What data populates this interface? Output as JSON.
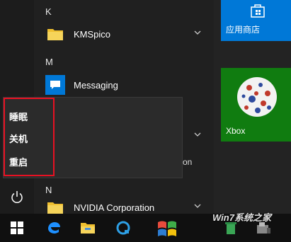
{
  "start_menu": {
    "sections": [
      {
        "letter": "K",
        "apps": [
          {
            "label": "KMSpico",
            "icon": "folder-icon",
            "has_chevron": true
          }
        ]
      },
      {
        "letter": "M",
        "apps": [
          {
            "label": "Messaging",
            "icon": "message-icon",
            "has_chevron": false
          }
        ]
      },
      {
        "letter": "N",
        "apps": [
          {
            "label": "NVIDIA Corporation",
            "icon": "folder-icon",
            "has_chevron": true
          }
        ]
      }
    ],
    "partial_text": "on"
  },
  "power_popup": {
    "items": [
      {
        "label": "睡眠"
      },
      {
        "label": "关机"
      },
      {
        "label": "重启"
      }
    ],
    "highlight_color": "#e81123"
  },
  "tiles": [
    {
      "label": "应用商店",
      "color": "#0078d7",
      "icon": "store-icon"
    },
    {
      "label": "Xbox",
      "color": "#107c10",
      "icon": "xbox-image"
    }
  ],
  "taskbar": {
    "items": [
      "windows-start-icon",
      "edge-icon",
      "file-explorer-icon",
      "cortana-icon",
      "windows-logo-icon",
      "recycle-bin-icon",
      "app-icon"
    ]
  },
  "watermark": {
    "text": "Win7系统之家"
  }
}
